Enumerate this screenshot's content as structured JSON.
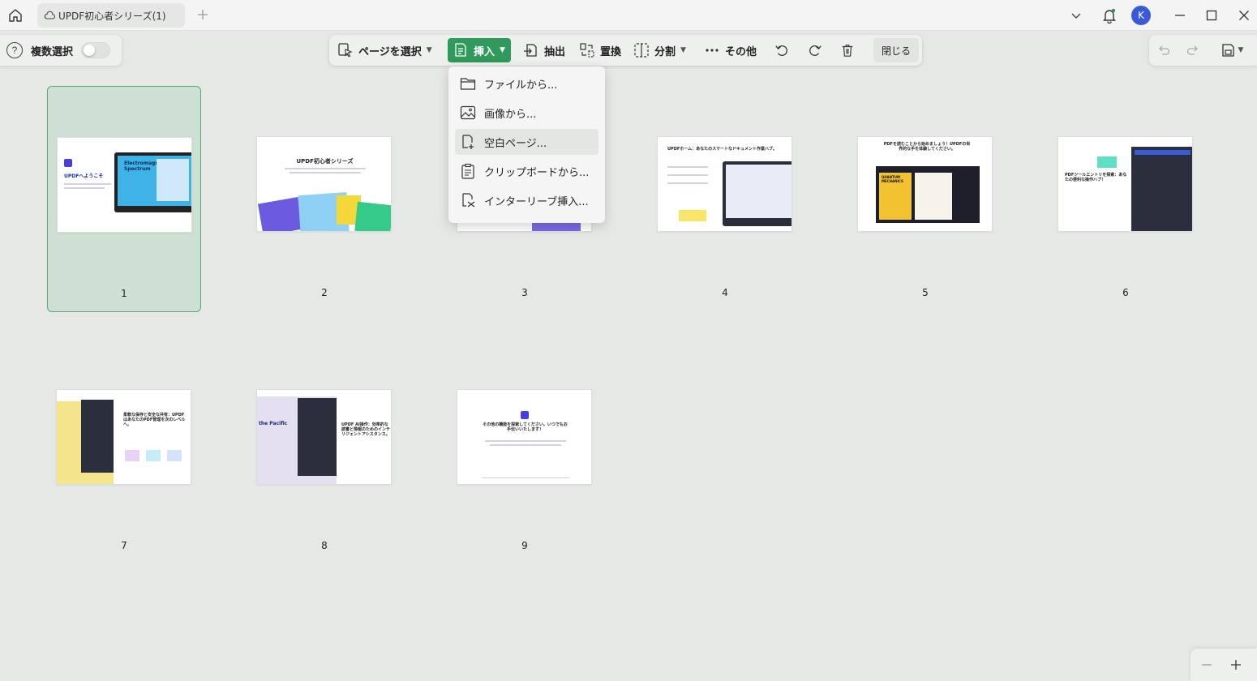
{
  "titlebar": {
    "tab_title": "UPDF初心者シリーズ(1)",
    "avatar_letter": "K"
  },
  "left_panel": {
    "multi_select_label": "複数選択",
    "multi_select_on": false
  },
  "toolbar": {
    "select_page": "ページを選択",
    "insert": "挿入",
    "extract": "抽出",
    "replace": "置換",
    "split": "分割",
    "more": "その他",
    "close": "閉じる"
  },
  "insert_menu": {
    "items": [
      {
        "label": "ファイルから...",
        "icon": "folder-icon"
      },
      {
        "label": "画像から...",
        "icon": "image-icon"
      },
      {
        "label": "空白ページ...",
        "icon": "blank-page-icon"
      },
      {
        "label": "クリップボードから...",
        "icon": "clipboard-icon"
      },
      {
        "label": "インターリーブ挿入...",
        "icon": "interleave-icon"
      }
    ],
    "hovered_index": 2
  },
  "pages": [
    {
      "number": "1",
      "selected": true,
      "heading": "UPDFへようこそ",
      "sub": "Electromagnetic Spectrum"
    },
    {
      "number": "2",
      "selected": false,
      "heading": "UPDF初心者シリーズ"
    },
    {
      "number": "3",
      "selected": false
    },
    {
      "number": "4",
      "selected": false,
      "heading": "UPDFホーム：あなたのスマートなドキュメント作業ハブ。"
    },
    {
      "number": "5",
      "selected": false,
      "heading": "PDFを読むことから始めましょう！UPDFの世界的な手を体験してください。",
      "sub": "QUANTUM MECHANICS"
    },
    {
      "number": "6",
      "selected": false,
      "heading": "PDFツールエントリを探索：あなたの便利な操作ハブ！"
    },
    {
      "number": "7",
      "selected": false,
      "heading": "柔軟な保存と安全な共有：UPDFはあなたのPDF管理を次のレベルへ。"
    },
    {
      "number": "8",
      "selected": false,
      "heading": "UPDF AI操作：効率的な読書と情報のためのインテリジェントアシスタンス。",
      "sub": "the Pacific"
    },
    {
      "number": "9",
      "selected": false,
      "heading": "その他の機能を探索してください。いつでもお手伝いいたします！"
    }
  ],
  "colors": {
    "accent": "#2f9a5c",
    "selected_bg": "#cde0d3",
    "avatar": "#3a5bd9"
  }
}
